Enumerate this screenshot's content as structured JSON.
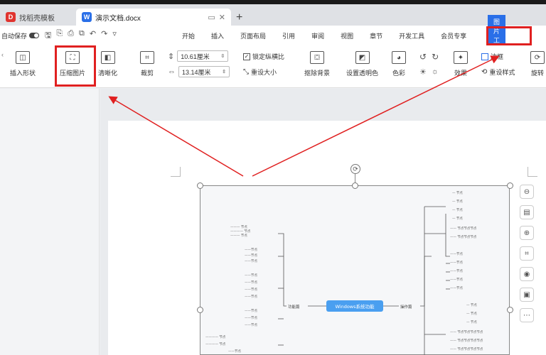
{
  "tabs": [
    {
      "label": "找稻壳模板",
      "logo": "D",
      "color": "#e0342f"
    },
    {
      "label": "演示文档.docx",
      "logo": "W",
      "color": "#2a6fe8"
    }
  ],
  "menubar": {
    "autosave": "自动保存",
    "items": [
      "开始",
      "插入",
      "页面布局",
      "引用",
      "审阅",
      "视图",
      "章节",
      "开发工具",
      "会员专享"
    ],
    "active": "图片工具"
  },
  "ribbon": {
    "insert_shape": "插入形状",
    "compress": "压缩图片",
    "transparent": "清晰化",
    "crop": "裁剪",
    "width_value": "10.61厘米",
    "height_value": "13.14厘米",
    "lock_ratio": "锁定纵横比",
    "reset_size": "重设大小",
    "remove_bg": "抠除背景",
    "set_transparent": "设置透明色",
    "color": "色彩",
    "effect": "效果",
    "border": "边框",
    "reset_style": "重设样式",
    "rotate": "旋转"
  },
  "mindmap": {
    "center": "Windows系统功能",
    "left_branch": "功能篇",
    "right_branch": "操作篇"
  }
}
